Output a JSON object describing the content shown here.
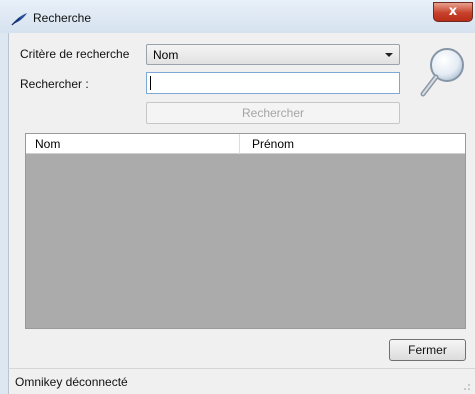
{
  "window": {
    "title": "Recherche",
    "close_glyph": "x"
  },
  "form": {
    "criteria_label": "Critère de recherche",
    "criteria_selected": "Nom",
    "search_label": "Rechercher :",
    "search_value": "",
    "search_button": "Rechercher"
  },
  "grid": {
    "columns": [
      "Nom",
      "Prénom"
    ],
    "rows": []
  },
  "buttons": {
    "close_label": "Fermer"
  },
  "status": {
    "text": "Omnikey déconnecté"
  },
  "icons": {
    "title": "feather-icon",
    "search": "magnifier-icon",
    "dropdown": "chevron-down-icon"
  }
}
